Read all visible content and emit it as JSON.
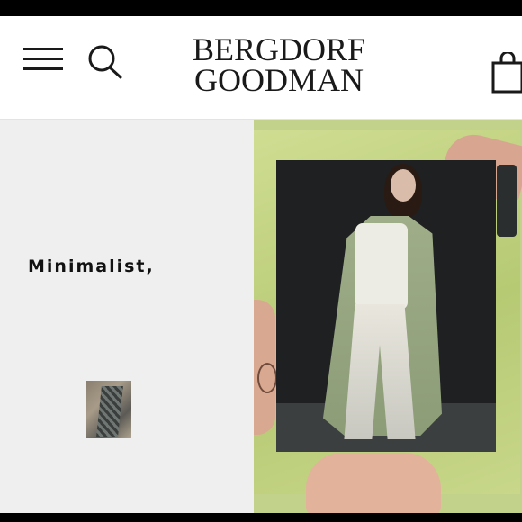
{
  "header": {
    "brand_line1": "BERGDORF",
    "brand_line2": "GOODMAN",
    "menu_icon": "hamburger-menu-icon",
    "search_icon": "search-icon",
    "bag_icon": "shopping-bag-icon"
  },
  "main": {
    "headline": "Minimalist,"
  },
  "colors": {
    "panel_left": "#efefef",
    "panel_right": "#c2d28a",
    "text": "#111111"
  }
}
